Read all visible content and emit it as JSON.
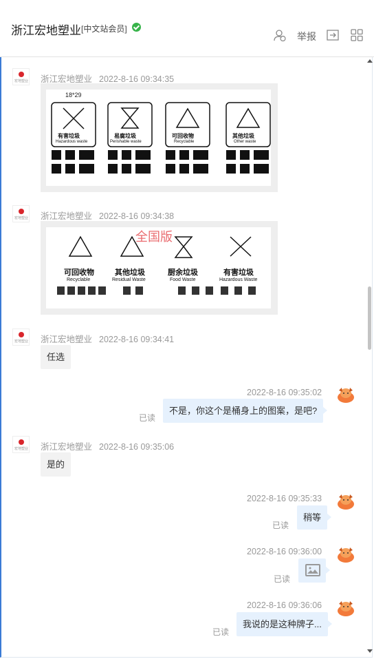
{
  "header": {
    "shop_name": "浙江宏地塑业",
    "member_badge": "[中文站会员]",
    "report_label": "举报",
    "icons": [
      "user-add-icon",
      "export-icon",
      "grid-icon",
      "verified-icon"
    ]
  },
  "messages": [
    {
      "side": "left",
      "sender": "浙江宏地塑业",
      "time": "2022-8-16 09:34:35",
      "type": "image",
      "image_label": "18*29",
      "bins": [
        {
          "cn": "有害垃圾",
          "en": "Hazardous waste"
        },
        {
          "cn": "易腐垃圾",
          "en": "Perishable waste"
        },
        {
          "cn": "可回收物",
          "en": "Recyclable"
        },
        {
          "cn": "其他垃圾",
          "en": "Other waste"
        }
      ]
    },
    {
      "side": "left",
      "sender": "浙江宏地塑业",
      "time": "2022-8-16 09:34:38",
      "type": "image",
      "image_label": "全国版",
      "bins": [
        {
          "cn": "可回收物",
          "en": "Recyclable"
        },
        {
          "cn": "其他垃圾",
          "en": "Residual Waste"
        },
        {
          "cn": "厨余垃圾",
          "en": "Food Waste"
        },
        {
          "cn": "有害垃圾",
          "en": "Hazardous Waste"
        }
      ]
    },
    {
      "side": "left",
      "sender": "浙江宏地塑业",
      "time": "2022-8-16 09:34:41",
      "type": "text",
      "text": "任选"
    },
    {
      "side": "right",
      "time": "2022-8-16 09:35:02",
      "type": "text",
      "text": "不是，你这个是桶身上的图案，是吧?",
      "status": "已读"
    },
    {
      "side": "left",
      "sender": "浙江宏地塑业",
      "time": "2022-8-16 09:35:06",
      "type": "text",
      "text": "是的"
    },
    {
      "side": "right",
      "time": "2022-8-16 09:35:33",
      "type": "text",
      "text": "稍等",
      "status": "已读"
    },
    {
      "side": "right",
      "time": "2022-8-16 09:36:00",
      "type": "image-placeholder",
      "status": "已读"
    },
    {
      "side": "right",
      "time": "2022-8-16 09:36:06",
      "type": "text",
      "text": "我说的是这种牌子...",
      "status": "已读"
    }
  ],
  "colors": {
    "accent": "#3a7bd5",
    "verified": "#37b34a",
    "bubble_right": "#e6f1fd",
    "bubble_left": "#f2f2f2",
    "brand_red": "#d9262c"
  }
}
